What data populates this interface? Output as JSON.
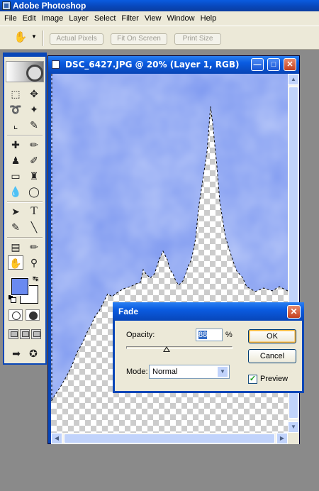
{
  "app": {
    "title": "Adobe Photoshop"
  },
  "menu": [
    "File",
    "Edit",
    "Image",
    "Layer",
    "Select",
    "Filter",
    "View",
    "Window",
    "Help"
  ],
  "options_bar": {
    "buttons": [
      "Actual Pixels",
      "Fit On Screen",
      "Print Size"
    ]
  },
  "tools": {
    "foreground_color": "#6a8af0",
    "background_color": "#ffffff",
    "items": [
      "rectangular-marquee",
      "move",
      "lasso",
      "magic-wand",
      "crop",
      "slice",
      "healing-brush",
      "brush",
      "clone-stamp",
      "history-brush",
      "eraser",
      "paint-bucket",
      "blur",
      "dodge",
      "path-selection",
      "type",
      "pen",
      "line",
      "notes",
      "eyedropper",
      "hand",
      "zoom"
    ]
  },
  "document": {
    "title": "DSC_6427.JPG @ 20% (Layer 1, RGB)",
    "zoom": "20%",
    "sky_color": "#7d98f0"
  },
  "fade_dialog": {
    "title": "Fade",
    "opacity_label": "Opacity:",
    "opacity_value": "88",
    "opacity_unit": "%",
    "opacity_slider_fraction": 0.38,
    "mode_label": "Mode:",
    "mode_value": "Normal",
    "ok_label": "OK",
    "cancel_label": "Cancel",
    "preview_label": "Preview",
    "preview_checked": true
  }
}
